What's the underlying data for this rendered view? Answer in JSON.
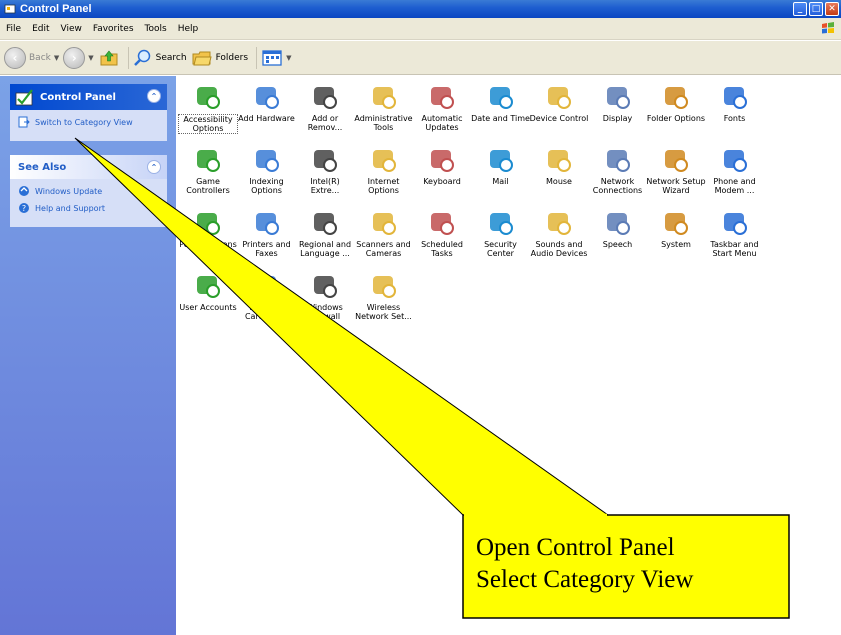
{
  "window": {
    "title": "Control Panel",
    "minimize": "_",
    "maximize": "□",
    "close": "✕"
  },
  "menu": [
    "File",
    "Edit",
    "View",
    "Favorites",
    "Tools",
    "Help"
  ],
  "toolbar": {
    "back": "Back",
    "search": "Search",
    "folders": "Folders"
  },
  "left_pane": {
    "control_panel": {
      "title": "Control Panel",
      "link": "Switch to Category View"
    },
    "see_also": {
      "title": "See Also",
      "links": [
        "Windows Update",
        "Help and Support"
      ]
    }
  },
  "items": [
    {
      "label": "Accessibility Options",
      "icon": "accessibility-icon"
    },
    {
      "label": "Add Hardware",
      "icon": "add-hardware-icon"
    },
    {
      "label": "Add or Remov...",
      "icon": "add-remove-programs-icon"
    },
    {
      "label": "Administrative Tools",
      "icon": "administrative-tools-icon"
    },
    {
      "label": "Automatic Updates",
      "icon": "automatic-updates-icon"
    },
    {
      "label": "Date and Time",
      "icon": "date-time-icon"
    },
    {
      "label": "Device Control",
      "icon": "device-control-icon"
    },
    {
      "label": "Display",
      "icon": "display-icon"
    },
    {
      "label": "Folder Options",
      "icon": "folder-options-icon"
    },
    {
      "label": "Fonts",
      "icon": "fonts-icon"
    },
    {
      "label": "Game Controllers",
      "icon": "game-controllers-icon"
    },
    {
      "label": "Indexing Options",
      "icon": "indexing-options-icon"
    },
    {
      "label": "Intel(R) Extre...",
      "icon": "intel-graphics-icon"
    },
    {
      "label": "Internet Options",
      "icon": "internet-options-icon"
    },
    {
      "label": "Keyboard",
      "icon": "keyboard-icon"
    },
    {
      "label": "Mail",
      "icon": "mail-icon"
    },
    {
      "label": "Mouse",
      "icon": "mouse-icon"
    },
    {
      "label": "Network Connections",
      "icon": "network-connections-icon"
    },
    {
      "label": "Network Setup Wizard",
      "icon": "network-setup-icon"
    },
    {
      "label": "Phone and Modem ...",
      "icon": "phone-modem-icon"
    },
    {
      "label": "Power Options",
      "icon": "power-options-icon"
    },
    {
      "label": "Printers and Faxes",
      "icon": "printers-faxes-icon"
    },
    {
      "label": "Regional and Language ...",
      "icon": "regional-language-icon"
    },
    {
      "label": "Scanners and Cameras",
      "icon": "scanners-cameras-icon"
    },
    {
      "label": "Scheduled Tasks",
      "icon": "scheduled-tasks-icon"
    },
    {
      "label": "Security Center",
      "icon": "security-center-icon"
    },
    {
      "label": "Sounds and Audio Devices",
      "icon": "sounds-audio-icon"
    },
    {
      "label": "Speech",
      "icon": "speech-icon"
    },
    {
      "label": "System",
      "icon": "system-icon"
    },
    {
      "label": "Taskbar and Start Menu",
      "icon": "taskbar-start-menu-icon"
    },
    {
      "label": "User Accounts",
      "icon": "user-accounts-icon"
    },
    {
      "label": "Windows CardSpace",
      "icon": "cardspace-icon"
    },
    {
      "label": "Windows Firewall",
      "icon": "firewall-icon"
    },
    {
      "label": "Wireless Network Set...",
      "icon": "wireless-network-icon"
    }
  ],
  "callout": {
    "line1": "Open Control Panel",
    "line2": "Select Category View"
  },
  "colors": {
    "xp_blue": "#0a46c2",
    "pane_bg": "#d6dff7",
    "link": "#215dc6",
    "callout_fill": "#ffff00"
  }
}
